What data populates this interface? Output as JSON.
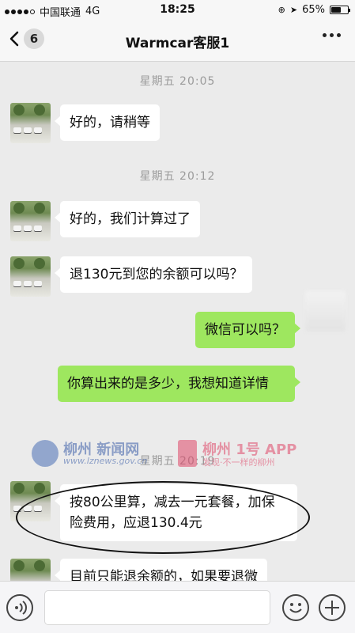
{
  "status": {
    "carrier": "中国联通",
    "network": "4G",
    "time": "18:25",
    "battery": "65%",
    "battery_level": 0.65
  },
  "nav": {
    "back_count": "6",
    "title": "Warmcar客服1"
  },
  "messages": [
    {
      "type": "time",
      "text": "星期五 20:05"
    },
    {
      "type": "left",
      "text": "好的，请稍等"
    },
    {
      "type": "time",
      "text": "星期五 20:12"
    },
    {
      "type": "left",
      "text": "好的，我们计算过了"
    },
    {
      "type": "left",
      "text": "退130元到您的余额可以吗？"
    },
    {
      "type": "right",
      "text": "微信可以吗？"
    },
    {
      "type": "right",
      "text": "你算出来的是多少，我想知道详情"
    },
    {
      "type": "time",
      "text": "星期五 20:19"
    },
    {
      "type": "left",
      "text": "按80公里算，减去一元套餐，加保险费用，应退130.4元"
    },
    {
      "type": "left",
      "text": "目前只能退余额的，如果要退微"
    }
  ],
  "watermark": {
    "brand1": "柳州 新闻网",
    "url": "www.lznews.gov.cn",
    "brand2": "柳州 1号 APP",
    "slogan": "发现·不一样的柳州"
  }
}
